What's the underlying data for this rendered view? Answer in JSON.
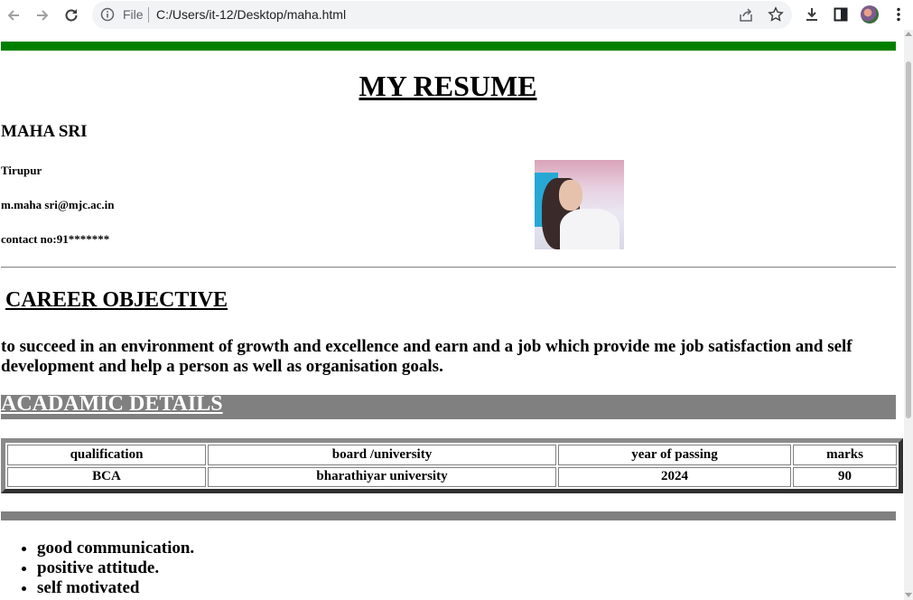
{
  "browser": {
    "scheme_label": "File",
    "url": "C:/Users/it-12/Desktop/maha.html"
  },
  "colors": {
    "top_bar": "#008000",
    "section_bar": "#808080",
    "chrome_omnibox": "#f1f3f4"
  },
  "icons": [
    "back-icon",
    "forward-icon",
    "reload-icon",
    "info-icon",
    "share-icon",
    "star-icon",
    "download-icon",
    "side-panel-icon",
    "profile-avatar",
    "menu-icon"
  ],
  "resume": {
    "title": "MY RESUME",
    "name": "MAHA SRI",
    "city": "Tirupur",
    "email": "m.maha sri@mjc.ac.in",
    "contact": "contact no:91*******",
    "career_heading": "CAREER OBJECTIVE",
    "objective": "to succeed in an environment of growth and excellence and earn and a job which provide me job satisfaction and self development and help a person as well as organisation goals.",
    "academic_heading": "ACADAMIC DETAILS",
    "table": {
      "headers": [
        "qualification",
        "board /university",
        "year of passing",
        "marks"
      ],
      "rows": [
        [
          "BCA",
          "bharathiyar university",
          "2024",
          "90"
        ]
      ]
    },
    "skills": [
      "good communication.",
      "positive attitude.",
      "self motivated"
    ]
  }
}
